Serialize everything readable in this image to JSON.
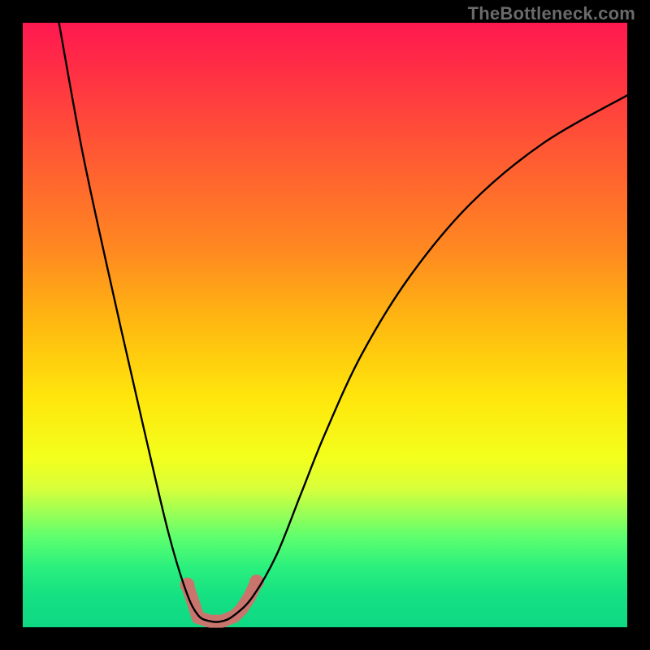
{
  "watermark": "TheBottleneck.com",
  "chart_data": {
    "type": "line",
    "title": "",
    "xlabel": "",
    "ylabel": "",
    "xlim": [
      0,
      100
    ],
    "ylim": [
      0,
      100
    ],
    "gradient_stops": [
      {
        "pos": 0,
        "color": "#ff1850"
      },
      {
        "pos": 8,
        "color": "#ff2f44"
      },
      {
        "pos": 22,
        "color": "#ff5a33"
      },
      {
        "pos": 38,
        "color": "#ff8a20"
      },
      {
        "pos": 50,
        "color": "#ffba10"
      },
      {
        "pos": 62,
        "color": "#ffe60c"
      },
      {
        "pos": 72,
        "color": "#f3ff1c"
      },
      {
        "pos": 77,
        "color": "#d8ff3a"
      },
      {
        "pos": 81,
        "color": "#9cff55"
      },
      {
        "pos": 85,
        "color": "#5fff6e"
      },
      {
        "pos": 90,
        "color": "#2bf07d"
      },
      {
        "pos": 95,
        "color": "#14e083"
      },
      {
        "pos": 100,
        "color": "#0fd883"
      }
    ],
    "series": [
      {
        "name": "bottleneck-curve",
        "x": [
          6,
          10,
          15,
          20,
          24,
          27,
          29,
          31,
          33,
          35,
          38,
          42,
          46,
          50,
          56,
          64,
          74,
          86,
          100
        ],
        "y": [
          100,
          78,
          55,
          33,
          16,
          6,
          2,
          1,
          1,
          2,
          5,
          12,
          22,
          32,
          45,
          58,
          70,
          80,
          88
        ]
      }
    ],
    "markers": {
      "name": "highlight-band",
      "color": "#c9756e",
      "cap_color": "#c9756e",
      "points": [
        {
          "x": 27.2,
          "y": 7.0
        },
        {
          "x": 27.9,
          "y": 5.0
        },
        {
          "x": 29.0,
          "y": 1.6
        },
        {
          "x": 31.0,
          "y": 1.0
        },
        {
          "x": 33.0,
          "y": 1.0
        },
        {
          "x": 35.0,
          "y": 1.8
        },
        {
          "x": 36.2,
          "y": 3.0
        },
        {
          "x": 37.5,
          "y": 5.0
        },
        {
          "x": 38.7,
          "y": 7.5
        }
      ]
    }
  }
}
